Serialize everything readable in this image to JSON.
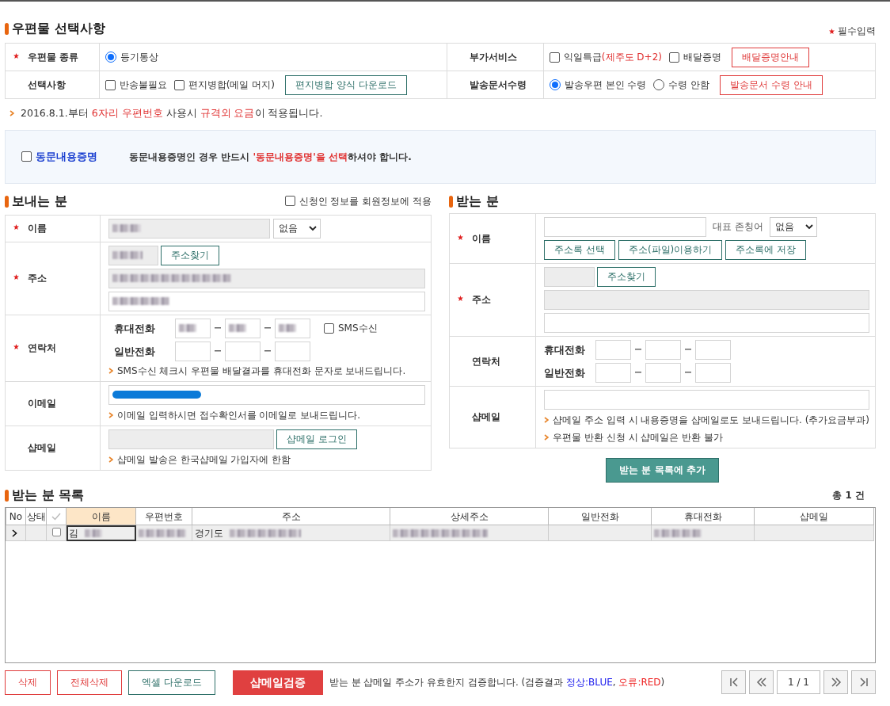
{
  "mail_options": {
    "title": "우편물 선택사항",
    "required_note": "필수입력",
    "rows": [
      [
        {
          "label": "우편물 종류",
          "required": true,
          "controls": [
            {
              "kind": "radio",
              "label": "등기통상",
              "checked": true
            }
          ]
        },
        {
          "label": "부가서비스",
          "required": false,
          "controls": [
            {
              "kind": "checkbox",
              "label": "익일특급",
              "note": "(제주도 D+2)",
              "checked": false
            },
            {
              "kind": "checkbox",
              "label": "배달증명",
              "checked": false
            },
            {
              "kind": "button",
              "color": "#e03c3c",
              "label": "배달증명안내"
            }
          ]
        }
      ],
      [
        {
          "label": "선택사항",
          "required": false,
          "controls": [
            {
              "kind": "checkbox",
              "label": "반송불필요",
              "checked": false
            },
            {
              "kind": "checkbox",
              "label": "편지병합(메일 머지)",
              "checked": false
            },
            {
              "kind": "button",
              "color": "#2d6f68",
              "label": "편지병합 양식 다운로드"
            }
          ]
        },
        {
          "label": "발송문서수령",
          "required": false,
          "controls": [
            {
              "kind": "radio",
              "label": "발송우편 본인 수령",
              "checked": true
            },
            {
              "kind": "radio",
              "label": "수령 안함",
              "checked": false
            },
            {
              "kind": "button",
              "color": "#e03c3c",
              "label": "발송문서 수령 안내"
            }
          ]
        }
      ]
    ],
    "notice": [
      {
        "text": "2016.8.1.부터 ",
        "highlight": false
      },
      {
        "text": "6자리 우편번호",
        "highlight": true
      },
      {
        "text": " 사용시 ",
        "highlight": false
      },
      {
        "text": "규격외 요금",
        "highlight": true
      },
      {
        "text": "이 적용됩니다.",
        "highlight": false
      }
    ]
  },
  "joint_certification": {
    "label": "동문내용증명",
    "checked": false,
    "message": [
      {
        "text": "동문내용증명인 경우 반드시 ",
        "highlight": false
      },
      {
        "text": "'동문내용증명'을 선택",
        "highlight": true
      },
      {
        "text": "하셔야 합니다.",
        "highlight": false
      }
    ]
  },
  "sender": {
    "title": "보내는 분",
    "apply_member": {
      "label": "신청인 정보를 회원정보에 적용",
      "checked": false
    },
    "name": {
      "label": "이름",
      "required": true,
      "blurred": true,
      "honorific": "없음"
    },
    "address": {
      "label": "주소",
      "required": true,
      "zip_blurred": true,
      "search_button": "주소찾기",
      "line1_blurred": true,
      "line2_blurred": true
    },
    "contact": {
      "label": "연락처",
      "required": true,
      "mobile_label": "휴대전화",
      "phone_label": "일반전화",
      "mobile_blurred": [
        true,
        true,
        true
      ],
      "sms": {
        "label": "SMS수신",
        "checked": false
      },
      "hint": "SMS수신 체크시 우편물 배달결과를 휴대전화 문자로 보내드립니다."
    },
    "email": {
      "label": "이메일",
      "required": false,
      "scribbled": true,
      "hint": "이메일 입력하시면 접수확인서를 이메일로 보내드립니다."
    },
    "shopmail": {
      "label": "샵메일",
      "required": false,
      "login_button": "샵메일 로그인",
      "hint": "샵메일 발송은 한국샵메일 가입자에 한함"
    }
  },
  "receiver": {
    "title": "받는 분",
    "name": {
      "label": "이름",
      "required": true,
      "honorific_label": "대표 존칭어",
      "honorific": "없음",
      "buttons": [
        "주소록 선택",
        "주소(파일)이용하기",
        "주소록에 저장"
      ]
    },
    "address": {
      "label": "주소",
      "required": true,
      "search_button": "주소찾기"
    },
    "contact": {
      "label": "연락처",
      "required": false,
      "mobile_label": "휴대전화",
      "phone_label": "일반전화"
    },
    "shopmail": {
      "label": "샵메일",
      "required": false,
      "hints": [
        "샵메일 주소 입력 시 내용증명을 샵메일로도 보내드립니다. (추가요금부과)",
        "우편물 반환 신청 시 샵메일은 반환 불가"
      ]
    },
    "add_button": "받는 분 목록에 추가"
  },
  "recipient_list": {
    "title": "받는 분 목록",
    "total": "총 1 건",
    "columns": [
      {
        "kind": "text",
        "label": "No",
        "selected": false
      },
      {
        "kind": "text",
        "label": "상태",
        "selected": false
      },
      {
        "kind": "check",
        "selected": false
      },
      {
        "kind": "text",
        "label": "이름",
        "selected": true
      },
      {
        "kind": "text",
        "label": "우편번호",
        "selected": false
      },
      {
        "kind": "text",
        "label": "주소",
        "selected": false
      },
      {
        "kind": "text",
        "label": "상세주소",
        "selected": false
      },
      {
        "kind": "text",
        "label": "일반전화",
        "selected": false
      },
      {
        "kind": "text",
        "label": "휴대전화",
        "selected": false
      },
      {
        "kind": "text",
        "label": "샵메일",
        "selected": false
      }
    ],
    "rows": [
      {
        "current": true,
        "cells": [
          {
            "kind": "pointer"
          },
          {
            "kind": "text"
          },
          {
            "kind": "checkbox",
            "checked": false
          },
          {
            "kind": "text",
            "text": "김",
            "blurred": true,
            "focused": true
          },
          {
            "kind": "text",
            "blurred": true
          },
          {
            "kind": "text",
            "text": "경기도",
            "blurred": true
          },
          {
            "kind": "text",
            "blurred": true
          },
          {
            "kind": "text"
          },
          {
            "kind": "text",
            "blurred": true
          },
          {
            "kind": "text"
          }
        ]
      }
    ]
  },
  "footer": {
    "buttons": [
      {
        "label": "삭제",
        "color": "#e03c3c"
      },
      {
        "label": "전체삭제",
        "color": "#e03c3c"
      },
      {
        "label": "엑셀 다운로드",
        "color": "#2d6f68"
      }
    ],
    "verify_button": "샵메일검증",
    "verify_note": [
      {
        "text": "받는 분 샵메일 주소가 유효한지 검증합니다. (검증결과 "
      },
      {
        "text": "정상:BLUE",
        "color": "#2222ee"
      },
      {
        "text": ", "
      },
      {
        "text": "오류:RED",
        "color": "#ee2222"
      },
      {
        "text": ")"
      }
    ],
    "pager": {
      "page": "1 / 1"
    }
  }
}
